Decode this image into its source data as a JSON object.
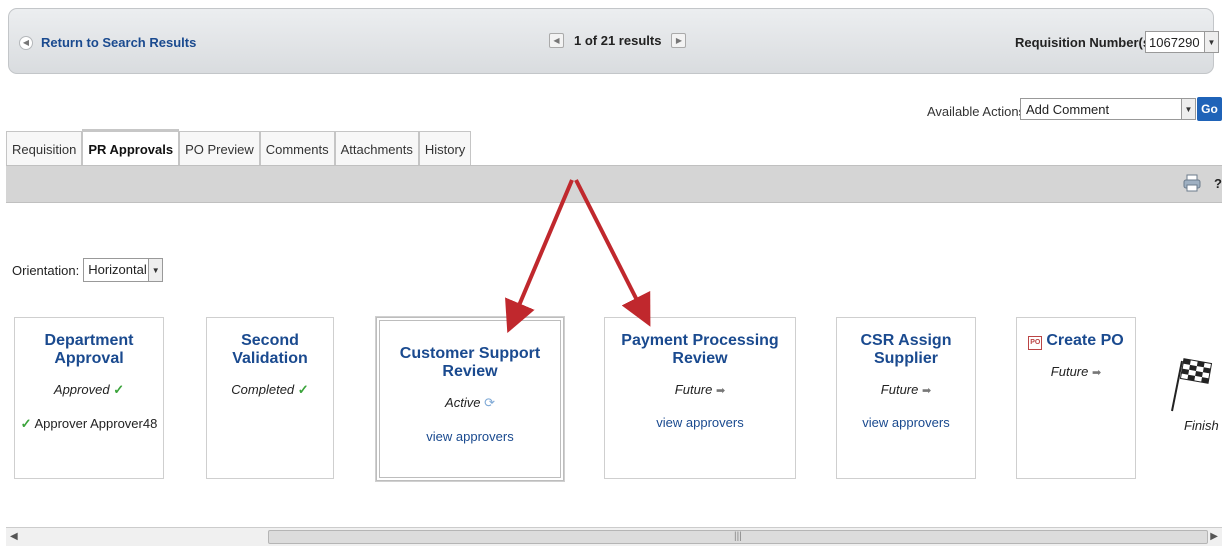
{
  "topbar": {
    "return_link": "Return to Search Results",
    "pager_text": "1 of 21 results",
    "req_label": "Requisition Number(s)",
    "req_value": "1067290"
  },
  "actions": {
    "label": "Available Actions:",
    "selected": "Add Comment",
    "go_label": "Go"
  },
  "tabs": [
    {
      "label": "Requisition"
    },
    {
      "label": "PR Approvals",
      "active": true
    },
    {
      "label": "PO Preview"
    },
    {
      "label": "Comments"
    },
    {
      "label": "Attachments"
    },
    {
      "label": "History"
    }
  ],
  "toolbar": {
    "help": "?"
  },
  "orientation": {
    "label": "Orientation:",
    "value": "Horizontal"
  },
  "steps": [
    {
      "title": "Department Approval",
      "status": "Approved",
      "approver": "Approver Approver48"
    },
    {
      "title": "Second Validation",
      "status": "Completed"
    },
    {
      "title": "Customer Support Review",
      "status": "Active",
      "link": "view approvers"
    },
    {
      "title": "Payment Processing Review",
      "status": "Future",
      "link": "view approvers"
    },
    {
      "title": "CSR Assign Supplier",
      "status": "Future",
      "link": "view approvers"
    },
    {
      "title": "Create PO",
      "status": "Future"
    }
  ],
  "finish": {
    "label": "Finish"
  },
  "colors": {
    "link": "#1a4a8f",
    "check": "#3aa33a",
    "annotation_arrow": "#c0282d",
    "go_button": "#1f63b8"
  }
}
